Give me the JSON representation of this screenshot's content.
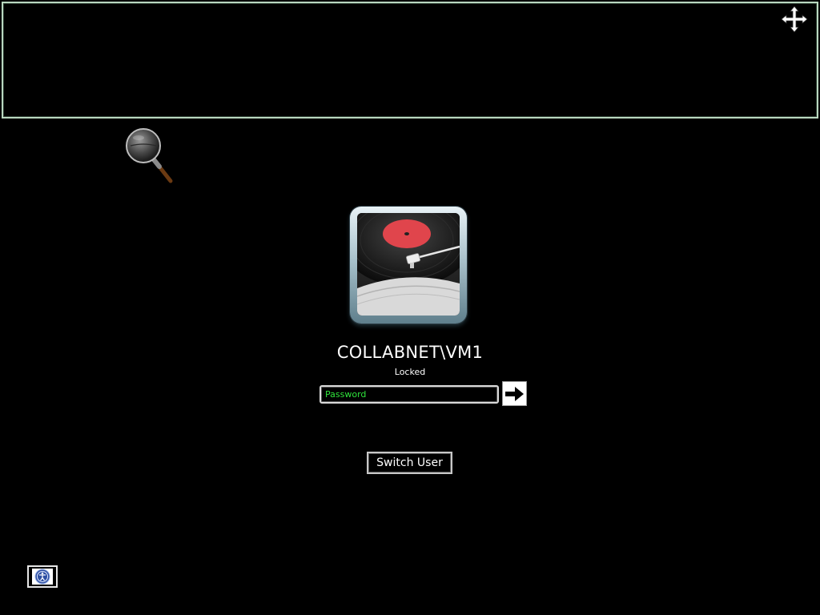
{
  "user": {
    "name": "COLLABNET\\VM1",
    "status": "Locked"
  },
  "password": {
    "placeholder": "Password",
    "value": ""
  },
  "buttons": {
    "switch_user_label": "Switch User"
  },
  "icons": {
    "submit": "arrow-right-icon",
    "ease_of_access": "ease-of-access-icon",
    "magnifier": "magnifier-lens-icon",
    "move_cursor": "move-cursor-icon"
  },
  "colors": {
    "background": "#000000",
    "panel_border": "#b9d7bf",
    "password_text": "#2fe33b",
    "text": "#ffffff"
  }
}
